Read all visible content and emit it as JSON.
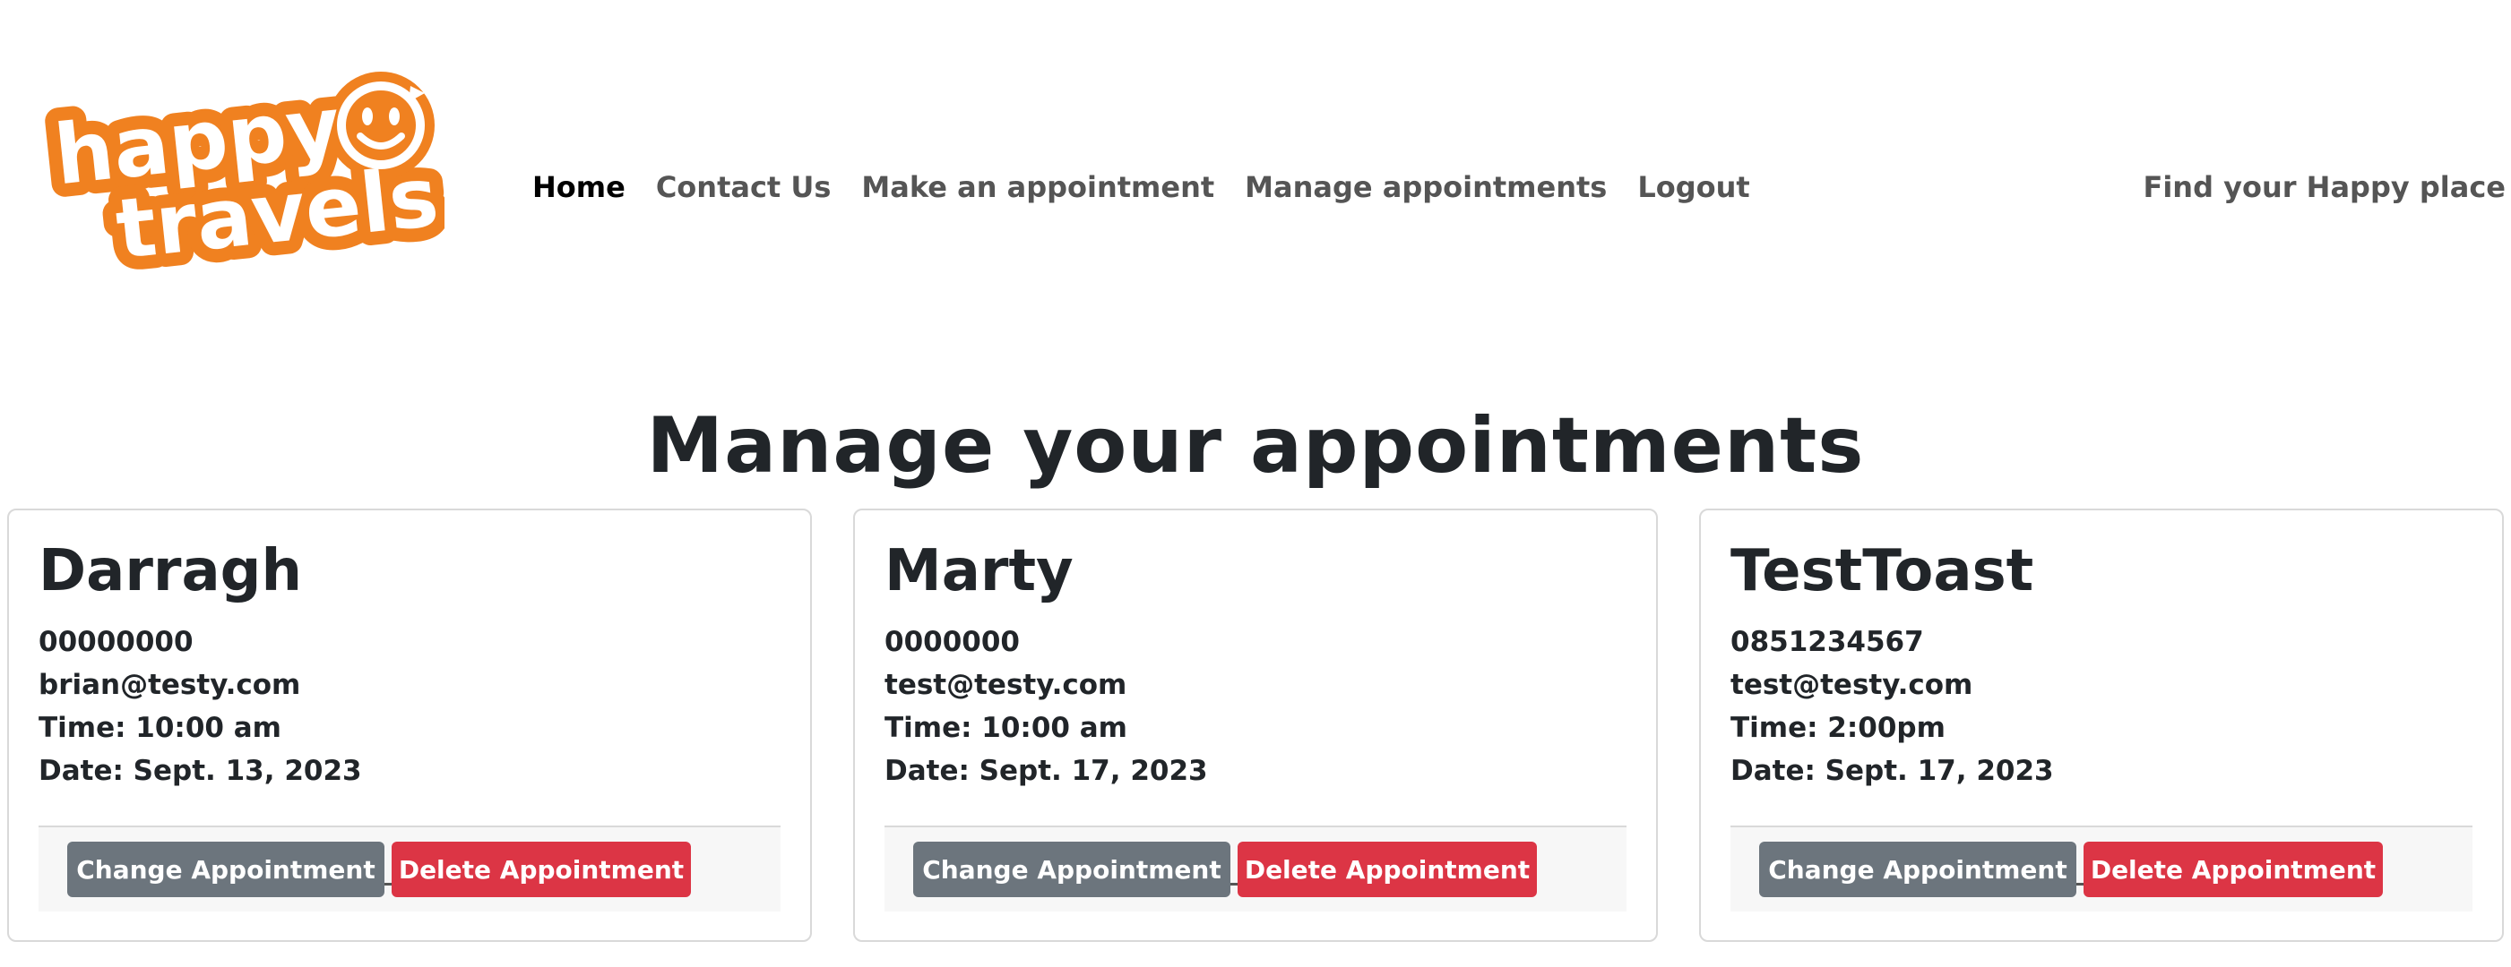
{
  "logo": {
    "line1": "happy",
    "line2": "travels",
    "icon": "smiley-face-icon",
    "color": "#f08120"
  },
  "nav": {
    "items": [
      {
        "label": "Home",
        "active": true
      },
      {
        "label": "Contact Us"
      },
      {
        "label": "Make an appointment"
      },
      {
        "label": "Manage appointments"
      },
      {
        "label": "Logout"
      }
    ],
    "tagline": "Find your Happy place"
  },
  "main": {
    "title": "Manage your appointments"
  },
  "appointments": [
    {
      "name": "Darragh",
      "phone": "00000000",
      "email": "brian@testy.com",
      "time": "Time: 10:00 am",
      "date": "Date: Sept. 13, 2023",
      "change_label": "Change Appointment",
      "delete_label": "Delete Appointment"
    },
    {
      "name": "Marty",
      "phone": "0000000",
      "email": "test@testy.com",
      "time": "Time: 10:00 am",
      "date": "Date: Sept. 17, 2023",
      "change_label": "Change Appointment",
      "delete_label": "Delete Appointment"
    },
    {
      "name": "TestToast",
      "phone": "0851234567",
      "email": "test@testy.com",
      "time": "Time: 2:00pm",
      "date": "Date: Sept. 17, 2023",
      "change_label": "Change Appointment",
      "delete_label": "Delete Appointment"
    }
  ],
  "colors": {
    "primary_text": "#212529",
    "nav_text": "#555555",
    "button_secondary": "#6c757d",
    "button_danger": "#dc3545",
    "card_border": "#d9d9d9",
    "footer_bg": "#f7f7f7"
  }
}
